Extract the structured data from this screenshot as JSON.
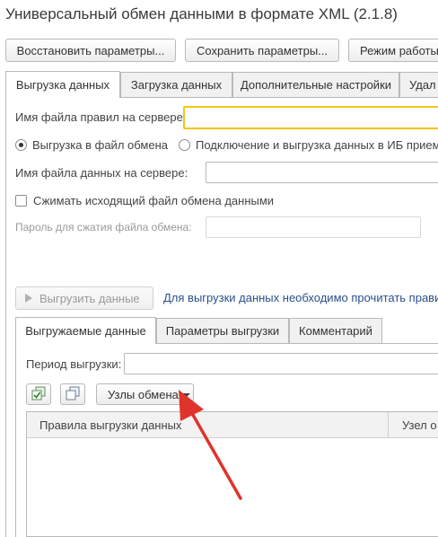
{
  "window": {
    "title": "Универсальный обмен данными в формате XML (2.1.8)"
  },
  "toolbar": {
    "restore_label": "Восстановить параметры...",
    "save_label": "Сохранить параметры...",
    "mode_label": "Режим работы"
  },
  "tabs": [
    {
      "label": "Выгрузка данных"
    },
    {
      "label": "Загрузка данных"
    },
    {
      "label": "Дополнительные настройки"
    },
    {
      "label": "Удал"
    }
  ],
  "export": {
    "rules_file_label": "Имя файла правил на сервере:",
    "rules_file_value": "",
    "radio_file_label": "Выгрузка в файл обмена",
    "radio_db_label": "Подключение и выгрузка данных в ИБ прием",
    "data_file_label": "Имя файла данных на сервере:",
    "data_file_value": "",
    "compress_label": "Сжимать исходящий файл обмена данными",
    "password_label": "Пароль для сжатия файла обмена:",
    "password_value": "",
    "export_button_label": "Выгрузить данные",
    "hint_link": "Для выгрузки данных необходимо прочитать прави"
  },
  "subtabs": [
    {
      "label": "Выгружаемые данные"
    },
    {
      "label": "Параметры выгрузки"
    },
    {
      "label": "Комментарий"
    }
  ],
  "period": {
    "label": "Период выгрузки:",
    "value": ""
  },
  "nodes_button_label": "Узлы обмена",
  "table": {
    "columns": [
      "Правила выгрузки данных",
      "Узел о"
    ]
  },
  "colors": {
    "field_highlight": "#f5c518",
    "arrow": "#e0332b",
    "link": "#2b4f8a"
  },
  "icons": [
    "check-all-icon",
    "uncheck-all-icon",
    "play-icon",
    "dropdown-arrow-icon"
  ]
}
